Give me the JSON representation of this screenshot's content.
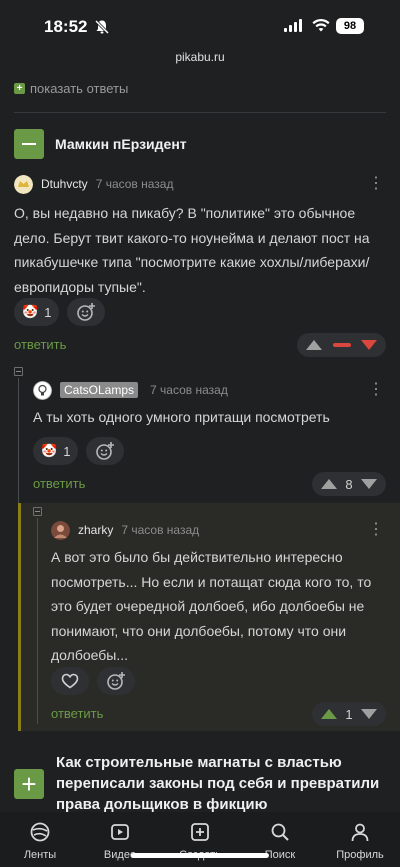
{
  "status": {
    "time": "18:52",
    "battery": "98",
    "url": "pikabu.ru"
  },
  "show_replies": "показать ответы",
  "story": {
    "title": "Мамкин пЕрзидент"
  },
  "comments": [
    {
      "user": "Dtuhvcty",
      "time": "7 часов назад",
      "text": "О, вы недавно на пикабу? В \"политике\" это обычное дело. Берут твит какого-то ноунейма и делают пост на пикабушечке типа \"посмотрите какие хохлы/либерахи/европидоры тупые\".",
      "reaction": {
        "emoji": "🤡",
        "count": "1"
      },
      "reply_label": "ответить",
      "rating": ""
    },
    {
      "user": "CatsOLamps",
      "time": "7 часов назад",
      "text": "А ты хоть одного умного притащи посмотреть",
      "reaction": {
        "emoji": "🤡",
        "count": "1"
      },
      "reply_label": "ответить",
      "rating": "8"
    },
    {
      "user": "zharky",
      "time": "7 часов назад",
      "text": "А вот это было бы действительно интересно посмотреть... Но если и потащат сюда кого то, то это будет очередной долбоеб, ибо долбоебы не понимают, что они долбоебы, потому что они долбоебы...",
      "reply_label": "ответить",
      "rating": "1"
    }
  ],
  "next_story": {
    "title": "Как строительные магнаты с властью переписали законы под себя и превратили права дольщиков в фикцию"
  },
  "tabs": [
    {
      "label": "Ленты",
      "icon": "feed-icon"
    },
    {
      "label": "Видео",
      "icon": "video-icon"
    },
    {
      "label": "Создать",
      "icon": "create-icon"
    },
    {
      "label": "Поиск",
      "icon": "search-icon"
    },
    {
      "label": "Профиль",
      "icon": "profile-icon"
    }
  ],
  "colors": {
    "accent": "#6b9a46",
    "downvote": "#d9473e",
    "highlight_bar": "#8a7e16"
  }
}
